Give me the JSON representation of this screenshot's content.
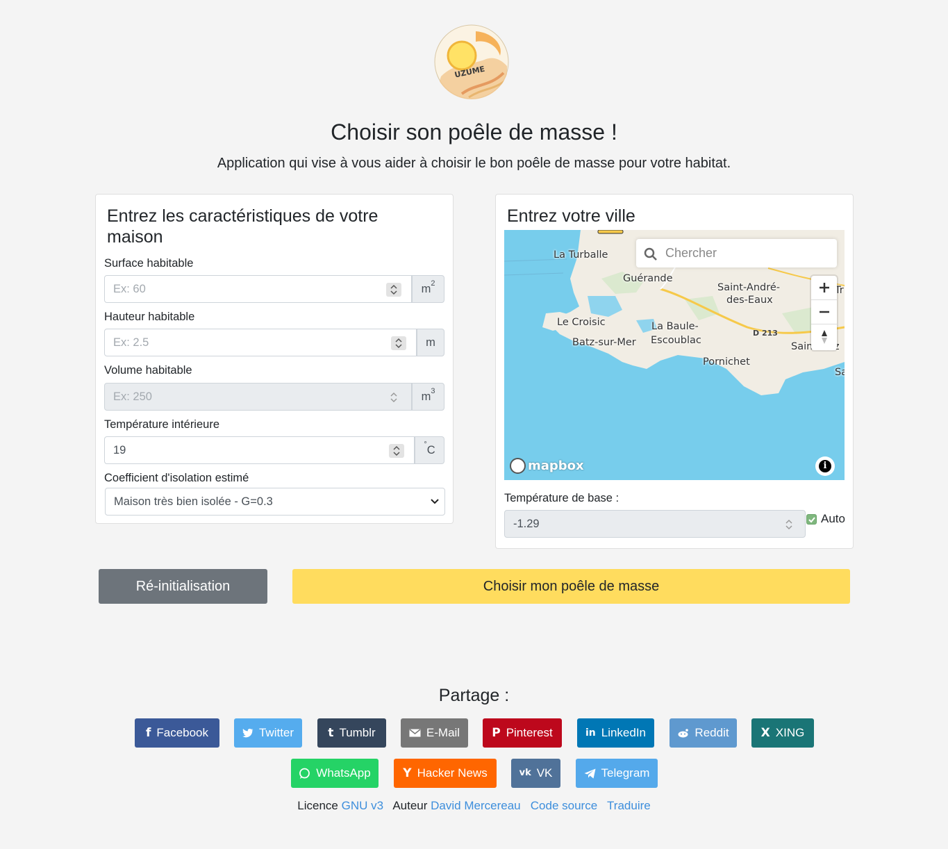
{
  "header": {
    "logo_text": "UZUME",
    "title": "Choisir son poêle de masse !",
    "subtitle": "Application qui vise à vous aider à choisir le bon poêle de masse pour votre habitat."
  },
  "house_card": {
    "title": "Entrez les caractéristiques de votre maison",
    "fields": [
      {
        "label": "Surface habitable",
        "placeholder": "Ex: 60",
        "value": "",
        "unit": "m",
        "unit_sup": "2"
      },
      {
        "label": "Hauteur habitable",
        "placeholder": "Ex: 2.5",
        "value": "",
        "unit": "m",
        "unit_sup": ""
      },
      {
        "label": "Volume habitable",
        "placeholder": "Ex: 250",
        "value": "",
        "unit": "m",
        "unit_sup": "3",
        "disabled": true
      },
      {
        "label": "Température intérieure",
        "placeholder": "",
        "value": "19",
        "unit": "C",
        "unit_sup": "°"
      }
    ],
    "isolation": {
      "label": "Coefficient d'isolation estimé",
      "selected": "Maison très bien isolée - G=0.3"
    }
  },
  "city_card": {
    "title": "Entrez votre ville",
    "map": {
      "search_placeholder": "Chercher",
      "attribution": "mapbox",
      "towns": [
        "La Turballe",
        "Guérande",
        "Saint-André-",
        "des-Eaux",
        "Le Croisic",
        "La Baule-",
        "Escoublac",
        "Batz-sur-Mer",
        "Pornichet",
        "Saint-Naz",
        "Sa",
        "Tr"
      ],
      "road_label": "D 213",
      "colors": {
        "sea": "#77cdec",
        "land": "#f1ede4",
        "road": "#f6c94a"
      }
    },
    "base_temp": {
      "label": "Température de base :",
      "value": "-1.29",
      "auto_label": "Auto",
      "auto_checked": true
    }
  },
  "actions": {
    "reset": "Ré-initialisation",
    "choose": "Choisir mon poêle de masse"
  },
  "share": {
    "title": "Partage :",
    "buttons": [
      {
        "label": "Facebook",
        "icon": "facebook-icon",
        "color": "#3b5998"
      },
      {
        "label": "Twitter",
        "icon": "twitter-icon",
        "color": "#55acee"
      },
      {
        "label": "Tumblr",
        "icon": "tumblr-icon",
        "color": "#35465c"
      },
      {
        "label": "E-Mail",
        "icon": "mail-icon",
        "color": "#777777"
      },
      {
        "label": "Pinterest",
        "icon": "pinterest-icon",
        "color": "#bd081c"
      },
      {
        "label": "LinkedIn",
        "icon": "linkedin-icon",
        "color": "#0077b5"
      },
      {
        "label": "Reddit",
        "icon": "reddit-icon",
        "color": "#5f99cf"
      },
      {
        "label": "XING",
        "icon": "xing-icon",
        "color": "#1a7576"
      },
      {
        "label": "WhatsApp",
        "icon": "whatsapp-icon",
        "color": "#25d366"
      },
      {
        "label": "Hacker News",
        "icon": "hackernews-icon",
        "color": "#ff6600"
      },
      {
        "label": "VK",
        "icon": "vk-icon",
        "color": "#507299"
      },
      {
        "label": "Telegram",
        "icon": "telegram-icon",
        "color": "#54a9eb"
      }
    ]
  },
  "footer": {
    "licence_label": "Licence",
    "licence_link": "GNU v3",
    "author_label": "Auteur",
    "author_link": "David Mercereau",
    "source_link": "Code source",
    "translate_link": "Traduire"
  }
}
